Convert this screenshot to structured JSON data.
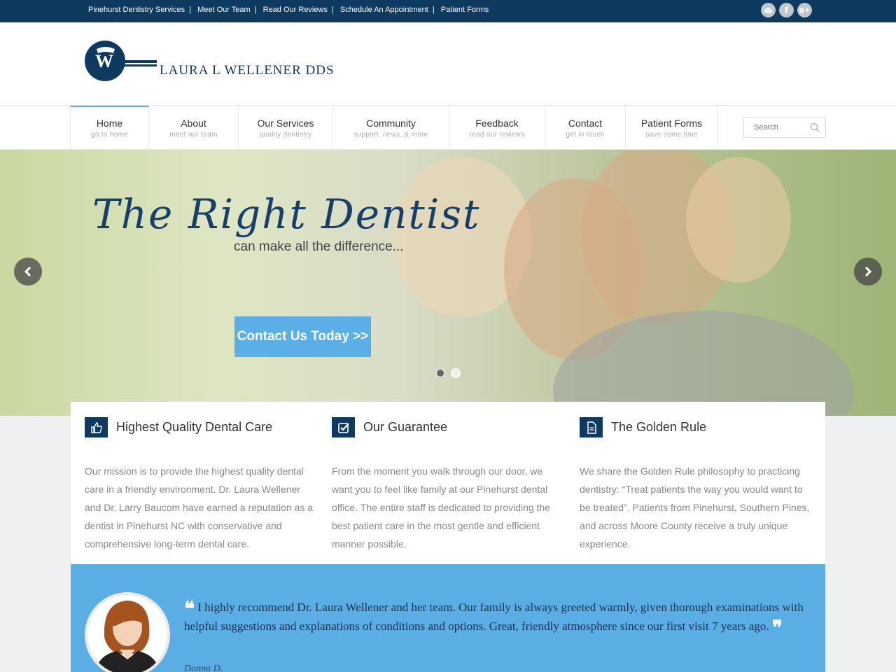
{
  "topbar": {
    "links": [
      "Pinehurst Dentistry Services",
      "Meet Our Team",
      "Read Our Reviews",
      "Schedule An Appointment",
      "Patient Forms"
    ],
    "social_icons": [
      "email-icon",
      "facebook-icon",
      "google-plus-icon"
    ]
  },
  "brand": {
    "name": "LAURA L WELLENER DDS",
    "logo_letter": "W",
    "color": "#0f3a60"
  },
  "nav": {
    "items": [
      {
        "label": "Home",
        "sub": "go to home"
      },
      {
        "label": "About",
        "sub": "meet our team"
      },
      {
        "label": "Our Services",
        "sub": "quality dentistry"
      },
      {
        "label": "Community",
        "sub": "support, news, & more"
      },
      {
        "label": "Feedback",
        "sub": "read our reviews"
      },
      {
        "label": "Contact",
        "sub": "get in touch"
      },
      {
        "label": "Patient Forms",
        "sub": "save some time"
      }
    ],
    "active_index": 0,
    "search_placeholder": "Search"
  },
  "hero": {
    "headline": "The Right Dentist",
    "subline": "can make all the difference...",
    "cta_label": "Contact Us Today >>",
    "slides": 2,
    "current_slide": 1,
    "accent": "#5aafe6"
  },
  "features": [
    {
      "icon": "thumbs-up-icon",
      "title": "Highest Quality Dental Care",
      "text": "Our mission is to provide the highest quality dental care in a friendly environment. Dr. Laura Wellener and Dr. Larry Baucom have earned a reputation as a dentist in Pinehurst NC with conservative and comprehensive long-term dental care."
    },
    {
      "icon": "checkbox-icon",
      "title": "Our Guarantee",
      "text": "From the moment you walk through our door, we want you to feel like family at our Pinehurst dental office. The entire staff is dedicated to providing the best patient care in the most gentle and efficient manner possible."
    },
    {
      "icon": "document-icon",
      "title": "The Golden Rule",
      "text": "We share the Golden Rule philosophy to practicing dentistry: “Treat patients the way you would want to be treated”. Patients from Pinehurst, Southern Pines, and across Moore County receive a truly unique experience."
    }
  ],
  "testimonial": {
    "open_quote": "❝",
    "close_quote": "❞",
    "text": "I highly recommend Dr. Laura Wellener and her team. Our family is always greeted warmly, given thorough examinations with helpful suggestions and explanations of conditions and options. Great, friendly atmosphere since our first visit 7 years ago.",
    "author": "Donna D.",
    "background": "#5aaee3"
  }
}
